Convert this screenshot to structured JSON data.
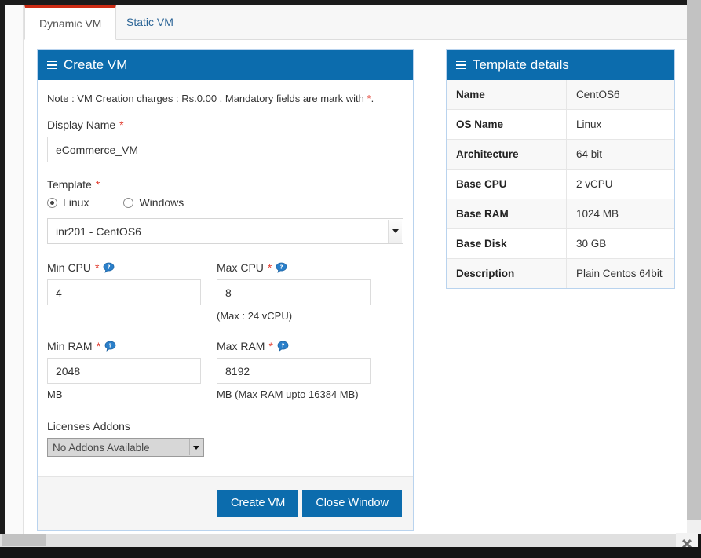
{
  "tabs": [
    {
      "label": "Dynamic VM",
      "active": true
    },
    {
      "label": "Static VM",
      "active": false
    }
  ],
  "create_vm": {
    "heading": "Create VM",
    "menu_icon": "hamburger-icon",
    "note_prefix": "Note : VM Creation charges : Rs.0.00 . Mandatory fields are mark with ",
    "note_required_mark": "*",
    "note_suffix": ".",
    "display_name": {
      "label": "Display Name",
      "required_mark": "*",
      "value": "eCommerce_VM",
      "placeholder": "Display Name"
    },
    "template": {
      "label": "Template",
      "required_mark": "*",
      "options": [
        {
          "label": "Linux",
          "selected": true
        },
        {
          "label": "Windows",
          "selected": false
        }
      ],
      "select_value": "inr201 - CentOS6"
    },
    "min_cpu": {
      "label": "Min CPU",
      "required_mark": "*",
      "help_icon": "help-question-icon",
      "value": "4",
      "hint": ""
    },
    "max_cpu": {
      "label": "Max CPU",
      "required_mark": "*",
      "help_icon": "help-question-icon",
      "value": "8",
      "hint": "(Max : 24 vCPU)"
    },
    "min_ram": {
      "label": "Min RAM",
      "required_mark": "*",
      "help_icon": "help-question-icon",
      "value": "2048",
      "hint": "MB"
    },
    "max_ram": {
      "label": "Max RAM",
      "required_mark": "*",
      "help_icon": "help-question-icon",
      "value": "8192",
      "hint": "MB  (Max RAM upto 16384 MB)"
    },
    "licenses_addons": {
      "label": "Licenses Addons",
      "select_value": "No Addons Available",
      "disabled": true
    },
    "buttons": {
      "create": "Create VM",
      "close": "Close Window"
    }
  },
  "template_details": {
    "heading": "Template details",
    "menu_icon": "hamburger-icon",
    "rows": [
      {
        "key": "Name",
        "value": "CentOS6"
      },
      {
        "key": "OS Name",
        "value": "Linux"
      },
      {
        "key": "Architecture",
        "value": "64 bit"
      },
      {
        "key": "Base CPU",
        "value": "2 vCPU"
      },
      {
        "key": "Base RAM",
        "value": "1024 MB"
      },
      {
        "key": "Base Disk",
        "value": "30 GB"
      },
      {
        "key": "Description",
        "value": "Plain Centos 64bit"
      }
    ]
  },
  "window_controls": {
    "close_icon": "close-x-icon"
  },
  "colors": {
    "panel_header_blue": "#0c6cad",
    "active_tab_accent_red": "#cc2b14",
    "required_red": "#e23b2e",
    "panel_border_blue": "#b9d3ee",
    "button_blue": "#0c6cad"
  }
}
